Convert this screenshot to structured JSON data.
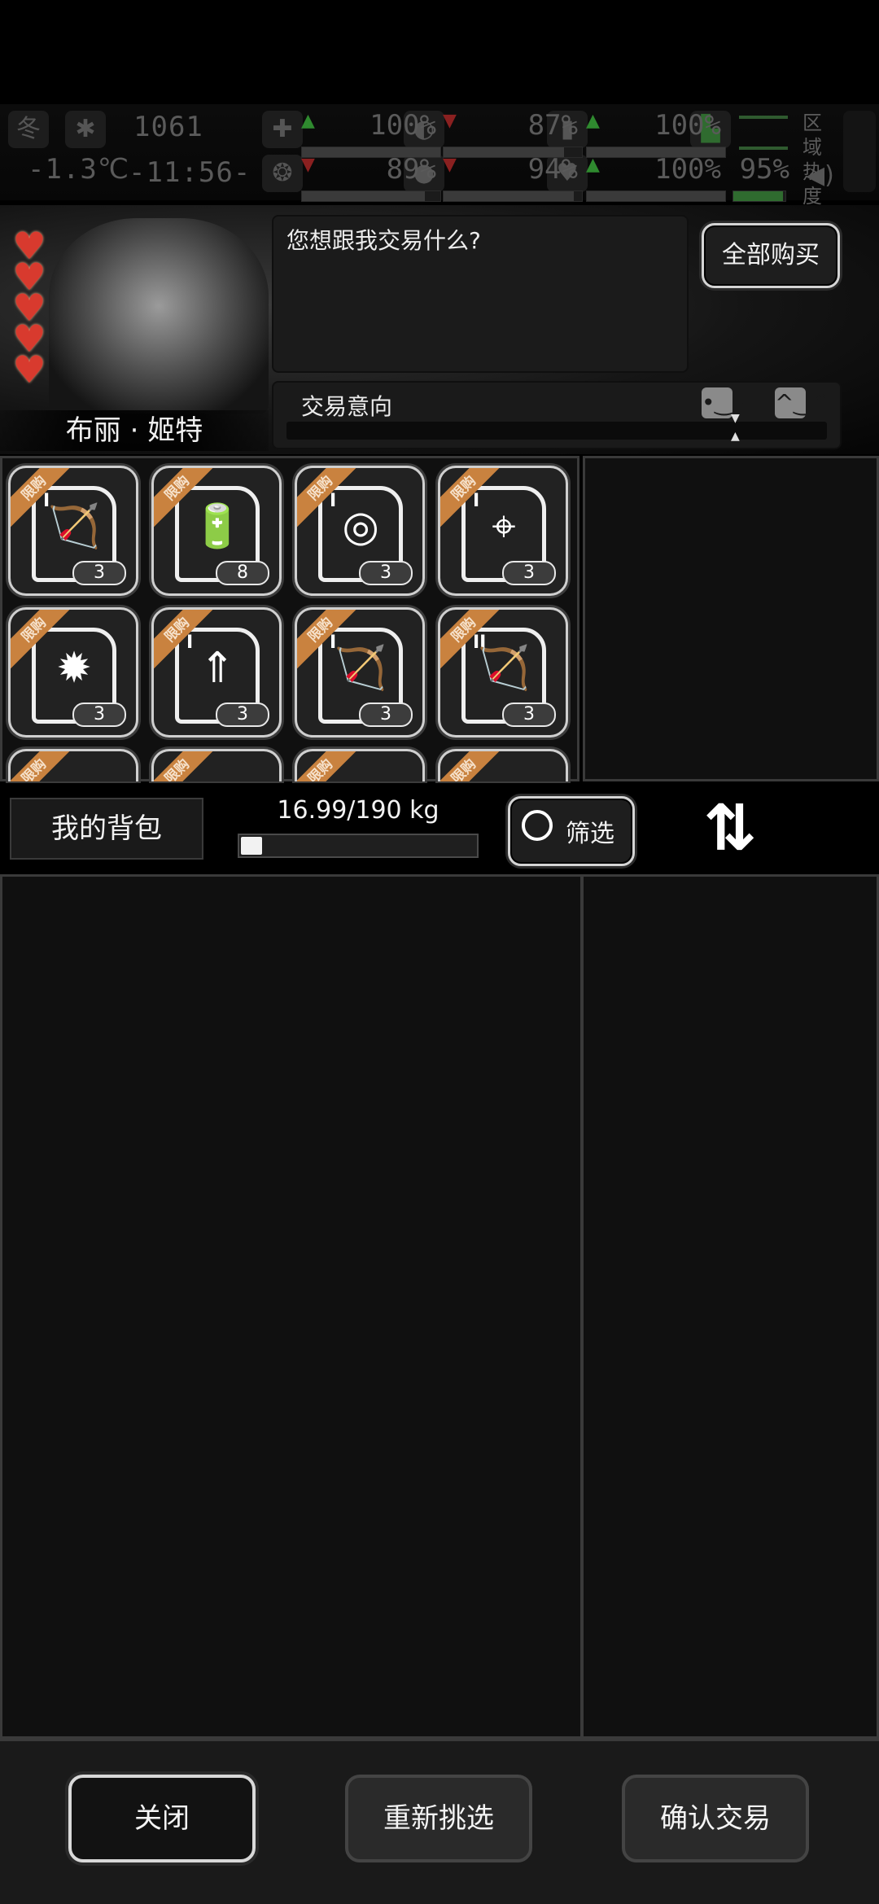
{
  "hud": {
    "season": "冬",
    "temperature": "-1.3℃",
    "day_counter": "1061",
    "clock": "-11:56-",
    "stats": [
      {
        "name": "health",
        "icon": "first-aid-icon",
        "value": "100%",
        "trend": "up",
        "level": 1.0,
        "color": "#5a5a5a"
      },
      {
        "name": "hunger",
        "icon": "stomach-icon",
        "value": "87%",
        "trend": "down",
        "level": 0.87,
        "color": "#5a5a5a"
      },
      {
        "name": "energy",
        "icon": "battery-icon",
        "value": "100%",
        "trend": "up",
        "level": 1.0,
        "color": "#5a5a5a"
      },
      {
        "name": "sanity",
        "icon": "brain-icon",
        "value": "89%",
        "trend": "down",
        "level": 0.89,
        "color": "#5a5a5a"
      },
      {
        "name": "thirst",
        "icon": "water-drop-icon",
        "value": "94%",
        "trend": "down",
        "level": 0.94,
        "color": "#5a5a5a"
      },
      {
        "name": "mood",
        "icon": "heart-icon",
        "value": "100%",
        "trend": "up",
        "level": 1.0,
        "color": "#5a5a5a"
      },
      {
        "name": "stamina",
        "icon": "boot-icon",
        "value": "95%",
        "trend": "none",
        "level": 0.95,
        "color": "#2f6b2f"
      }
    ],
    "zone_heat_label": "区域热度",
    "up_arrow_color": "#2f8a2f",
    "down_arrow_color": "#8a2020"
  },
  "trader": {
    "name": "布丽 · 姬特",
    "hearts": 5,
    "dialog": "您想跟我交易什么?",
    "buy_all": "全部购买",
    "intent_label": "交易意向",
    "heart_color": "#d83a2e"
  },
  "shop": {
    "ribbon_label": "限购",
    "ribbon_color": "#c9823f",
    "items": [
      {
        "icon": "bow-blueprint-icon",
        "glyph": "🏹",
        "tier": "I",
        "qty": "3"
      },
      {
        "icon": "battery-cell-icon",
        "glyph": "🔋",
        "tier": "",
        "qty": "8"
      },
      {
        "icon": "target-blueprint-icon",
        "glyph": "◎",
        "tier": "I",
        "qty": "3"
      },
      {
        "icon": "turret-blueprint-icon",
        "glyph": "⌖",
        "tier": "I",
        "qty": "3"
      },
      {
        "icon": "gun-blast-blueprint-icon",
        "glyph": "✹",
        "tier": "",
        "qty": "3"
      },
      {
        "icon": "gun-upgrade-blueprint-icon",
        "glyph": "⇑",
        "tier": "I",
        "qty": "3"
      },
      {
        "icon": "bow-blast-blueprint-icon",
        "glyph": "🏹",
        "tier": "I",
        "qty": "3"
      },
      {
        "icon": "bow-blueprint-icon",
        "glyph": "🏹",
        "tier": "II",
        "qty": "3"
      }
    ]
  },
  "backpack": {
    "title": "我的背包",
    "weight": "16.99/190 kg",
    "weight_fraction": 0.089,
    "filter": "筛选"
  },
  "footer": {
    "close": "关闭",
    "reselect": "重新挑选",
    "confirm": "确认交易"
  }
}
